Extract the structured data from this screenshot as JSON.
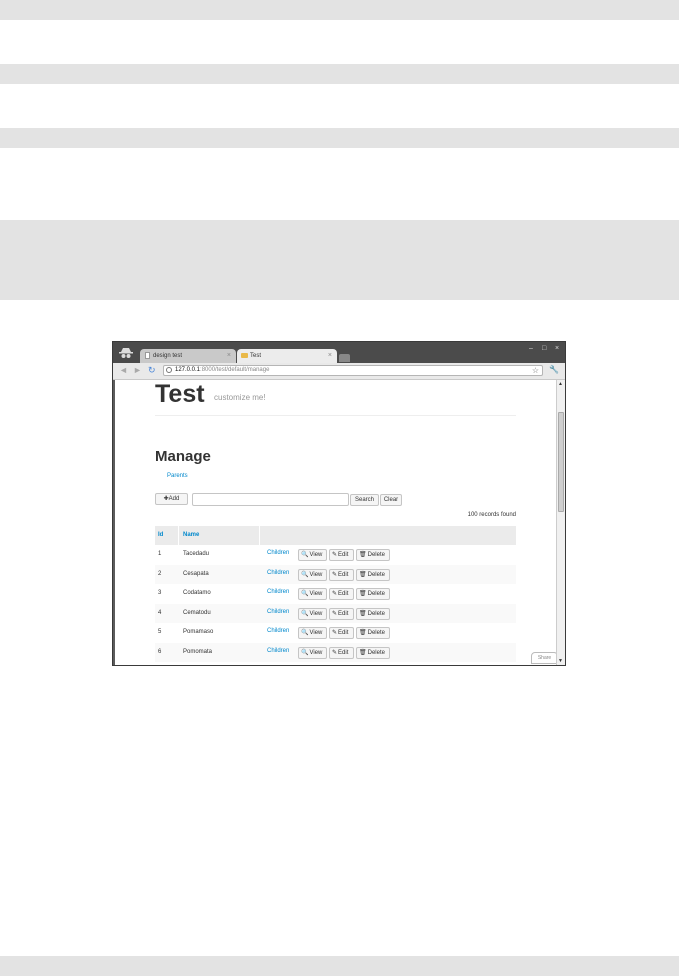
{
  "colors": {
    "page_band": "#e3e3e3",
    "link": "#0088cc",
    "chrome_frame": "#4b4b4b"
  },
  "browser": {
    "tabs": [
      {
        "title": "design test",
        "icon": "document-icon",
        "active": false
      },
      {
        "title": "Test",
        "icon": "folder-icon",
        "active": true
      }
    ],
    "tab_close": "×",
    "window_controls": {
      "minimize": "–",
      "maximize": "□",
      "close": "×"
    },
    "address": {
      "host": "127.0.0.1",
      "path": ":8000/test/default/manage"
    },
    "nav": {
      "back": "◄",
      "forward": "►",
      "reload": "↻",
      "bookmark": "☆",
      "settings": "🔧"
    }
  },
  "page": {
    "brand": "Test",
    "tagline": "customize me!",
    "heading": "Manage",
    "breadcrumb": "Parents",
    "add_button": "Add",
    "add_icon": "✚",
    "search_button": "Search",
    "clear_button": "Clear",
    "records_found": "100 records found",
    "columns": [
      "Id",
      "Name"
    ],
    "actions": {
      "children": "Children",
      "view": "View",
      "edit": "Edit",
      "delete": "Delete"
    },
    "rows": [
      {
        "id": "1",
        "name": "Tacedadu"
      },
      {
        "id": "2",
        "name": "Cesapata"
      },
      {
        "id": "3",
        "name": "Codatamo"
      },
      {
        "id": "4",
        "name": "Cematodu"
      },
      {
        "id": "5",
        "name": "Pomamaso"
      },
      {
        "id": "6",
        "name": "Pomomata"
      }
    ],
    "share": "Share"
  }
}
